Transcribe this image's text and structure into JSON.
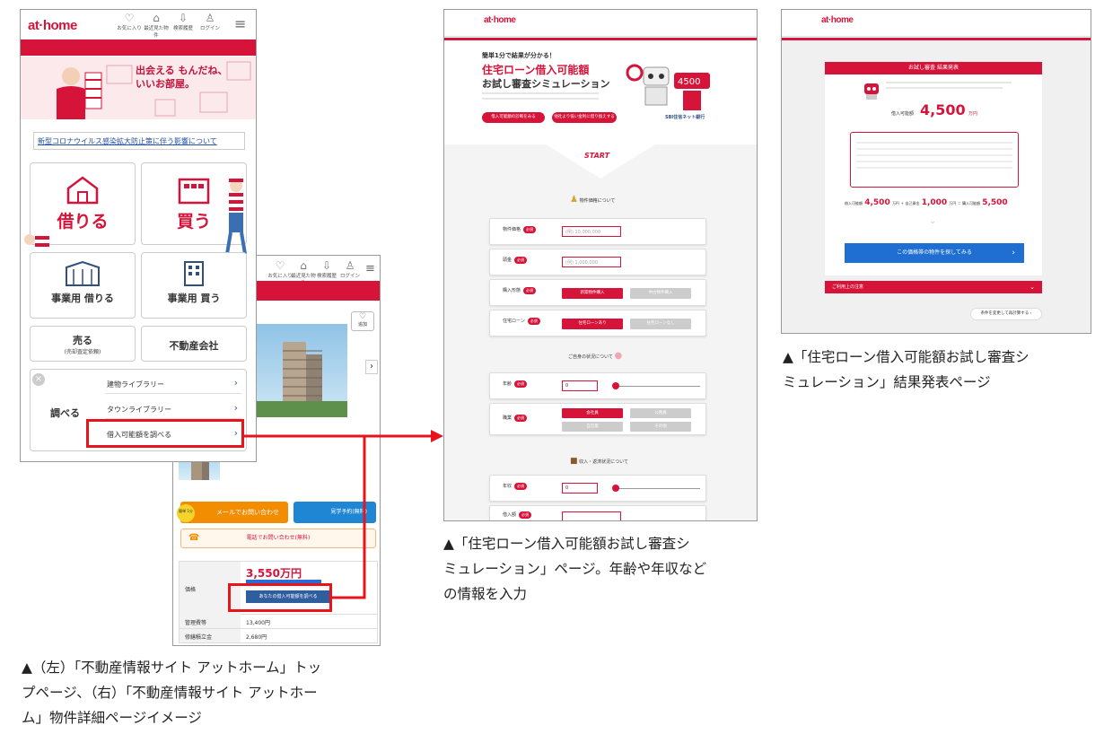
{
  "panel1": {
    "logo": "at·home",
    "header_icons": [
      {
        "icon": "heart-icon",
        "label": "お気に入り"
      },
      {
        "icon": "home-icon",
        "label": "最近見た物件"
      },
      {
        "icon": "history-icon",
        "label": "検索履歴"
      },
      {
        "icon": "user-icon",
        "label": "ログイン"
      }
    ],
    "banner_text": "出会える もんだね、いいお部屋。",
    "notice_link": "新型コロナウイルス感染拡大防止策に伴う影響について",
    "tiles": {
      "rent": "借りる",
      "buy": "買う",
      "biz_rent": "事業用 借りる",
      "biz_buy": "事業用 買う",
      "sell": "売る",
      "sell_sub": "(売却査定依頼)",
      "agency": "不動産会社"
    },
    "research": {
      "title": "調べる",
      "items": [
        "建物ライブラリー",
        "タウンライブラリー",
        "借入可能額を調べる"
      ]
    }
  },
  "panel2": {
    "fav_label": "追加",
    "mail_button": "メールでお問い合わせ",
    "visit_button": "見学予約(無料)",
    "phone_button": "電話でお問い合わせ(無料)",
    "badge": "簡単 1分",
    "price": "3,550万円",
    "price_label": "価格",
    "borrow_button": "あなたの借入可能額を調べる",
    "rows": [
      {
        "label": "管理費等",
        "value": "13,400円"
      },
      {
        "label": "修繕積立金",
        "value": "2,680円"
      }
    ]
  },
  "panel3": {
    "logo": "at·home",
    "lead": "簡単1分で結果が分かる！",
    "title1": "住宅ローン借入可能額",
    "title2": "お試し審査シミュレーション",
    "btn1": "借入可能額の診断をみる",
    "btn2": "他社より低い金利に借り換えする",
    "partner": "SBI住信ネット銀行",
    "start": "START",
    "section1": "物件価格について",
    "section2": "ご自身の状況について",
    "section3": "収入・返済状況について",
    "rows": [
      {
        "label": "物件価格",
        "input": "(例) 10,000,000"
      },
      {
        "label": "頭金",
        "input": "(例) 1,000,000"
      },
      {
        "label": "購入形態"
      },
      {
        "label": "住宅ローン"
      },
      {
        "label": "年齢"
      },
      {
        "label": "職業"
      },
      {
        "label": "年収"
      },
      {
        "label": "借入額"
      }
    ],
    "choice_buttons": [
      "新築物件購入",
      "中古物件購入",
      "住宅ローンあり",
      "住宅ローンなし",
      "会社員",
      "公務員",
      "自営業",
      "その他"
    ]
  },
  "panel4": {
    "logo": "at·home",
    "result_header": "お試し審査 結果発表",
    "amount_label": "借入可能額",
    "amount": "4,500",
    "unit": "万円",
    "formula": [
      "4,500",
      "1,000",
      "5,500"
    ],
    "cta": "この価格帯の物件を探してみる",
    "accordion": "ご利用上の注意",
    "back": "条件を変更して再計算する"
  },
  "captions": {
    "c1": [
      "▲（左）「不動産情報サイト アットホーム」トッ",
      "プページ、（右）「不動産情報サイト アットホー",
      "ム」物件詳細ページイメージ"
    ],
    "c2": [
      "▲「住宅ローン借入可能額お試し審査シ",
      "ミュレーション」ページ。年齢や年収など",
      "の情報を入力"
    ],
    "c3": [
      "▲「住宅ローン借入可能額お試し審査シ",
      "ミュレーション」結果発表ページ"
    ]
  },
  "colors": {
    "brand_red": "#d6143a",
    "cta_blue": "#1e6fd1",
    "highlight_red": "#e8141c",
    "orange": "#f28c00"
  }
}
